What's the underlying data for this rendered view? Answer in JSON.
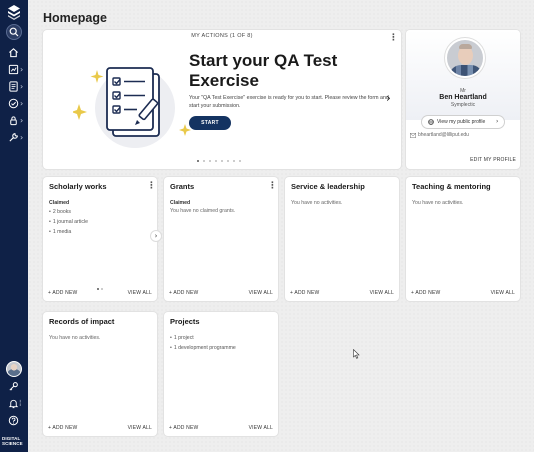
{
  "sidebar": {
    "brand_lines": [
      "DIGITAL",
      "SCIENCE"
    ],
    "chevron": "›",
    "icons": [
      "home-icon",
      "reports-icon",
      "list-icon",
      "check-circle-icon",
      "lock-icon",
      "wrench-icon",
      "key-icon",
      "bell-icon",
      "help-icon"
    ]
  },
  "page": {
    "title": "Homepage"
  },
  "actions": {
    "header": "MY ACTIONS (1 OF 8)",
    "title": "Start your QA Test Exercise",
    "description": "Your \"QA Test Exercise\" exercise is ready for you to start. Please review the form and start your submission.",
    "start_label": "START",
    "next_arrow": "›",
    "dot_count": 8,
    "active_dot": 0
  },
  "profile": {
    "salutation": "Mr",
    "name": "Ben Heartland",
    "organisation": "Symplectic",
    "public_profile_label": "View my public profile",
    "public_profile_chevron": "›",
    "email": "bheartland@lilliput.edu",
    "edit_label": "EDIT MY PROFILE"
  },
  "widgets": {
    "add_new_label": "+ ADD NEW",
    "view_all_label": "VIEW ALL",
    "more_glyph": "⋮",
    "scholarly": {
      "title": "Scholarly works",
      "subtitle": "Claimed",
      "items": [
        "2 books",
        "1 journal article",
        "1 media"
      ],
      "next_arrow": "›"
    },
    "grants": {
      "title": "Grants",
      "subtitle": "Claimed",
      "empty_text": "You have no claimed grants."
    },
    "service": {
      "title": "Service & leadership",
      "empty_text": "You have no activities."
    },
    "teaching": {
      "title": "Teaching & mentoring",
      "empty_text": "You have no activities."
    },
    "impact": {
      "title": "Records of impact",
      "empty_text": "You have no activities."
    },
    "projects": {
      "title": "Projects",
      "items": [
        "1 project",
        "1 development programme"
      ]
    }
  },
  "colors": {
    "sidebar_bg": "#0f2147",
    "primary_button": "#143361",
    "illustration_accent": "#e9c94a",
    "illustration_bg": "#edeef2"
  }
}
